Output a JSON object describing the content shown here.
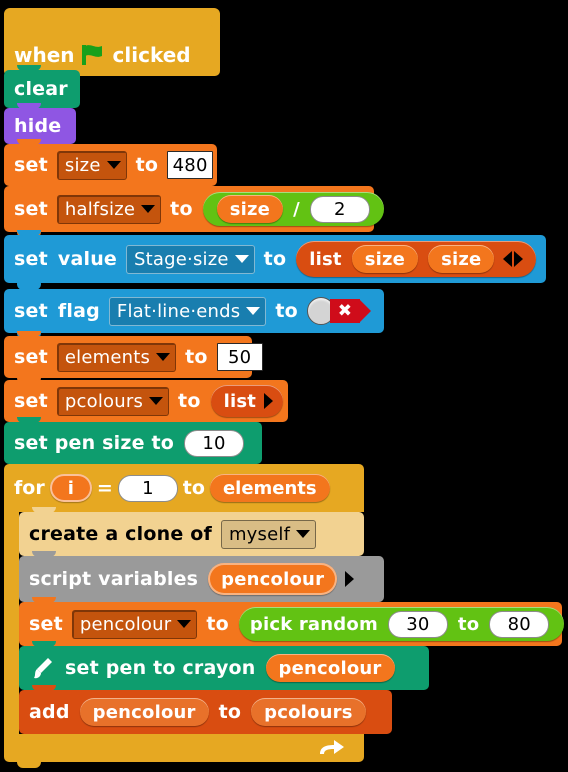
{
  "script": {
    "hat": {
      "word_when": "when",
      "icon": "green-flag-icon",
      "word_clicked": "clicked"
    },
    "blocks": [
      {
        "id": "clear",
        "label": "clear"
      },
      {
        "id": "hide",
        "label": "hide"
      },
      {
        "id": "set_size",
        "set": "set",
        "variable": "size",
        "to": "to",
        "value": "480"
      },
      {
        "id": "set_halfsize",
        "set": "set",
        "variable": "halfsize",
        "to": "to",
        "operator": {
          "left": "size",
          "symbol": "/",
          "right": "2"
        }
      },
      {
        "id": "set_value",
        "set": "set",
        "word": "value",
        "option": "Stage·size",
        "to": "to",
        "list": {
          "label": "list",
          "items": [
            "size",
            "size"
          ]
        }
      },
      {
        "id": "set_flag",
        "set": "set",
        "word": "flag",
        "option": "Flat·line·ends",
        "to": "to",
        "toggle": {
          "state": "off",
          "mark": "✖"
        }
      },
      {
        "id": "set_elements",
        "set": "set",
        "variable": "elements",
        "to": "to",
        "value": "50"
      },
      {
        "id": "set_pcolours",
        "set": "set",
        "variable": "pcolours",
        "to": "to",
        "list": {
          "label": "list",
          "items": []
        }
      },
      {
        "id": "set_pen_size",
        "label": "set pen size to",
        "value": "10"
      }
    ],
    "for_loop": {
      "word_for": "for",
      "index": "i",
      "equals": "=",
      "start": "1",
      "word_to": "to",
      "end": "elements",
      "body": [
        {
          "id": "clone",
          "label": "create a clone of",
          "option": "myself"
        },
        {
          "id": "script_vars",
          "label": "script variables",
          "vars": [
            "pencolour"
          ]
        },
        {
          "id": "set_pencolour",
          "set": "set",
          "variable": "pencolour",
          "to": "to",
          "operator": {
            "label": "pick random",
            "from": "30",
            "word_to": "to",
            "until": "80"
          }
        },
        {
          "id": "set_crayon",
          "icon": "paintbrush-icon",
          "label": "set pen to crayon",
          "arg": "pencolour"
        },
        {
          "id": "add_to_list",
          "word_add": "add",
          "item": "pencolour",
          "word_to": "to",
          "list": "pcolours"
        }
      ]
    }
  },
  "colors": {
    "control": "#e6a822",
    "pen": "#0e9d6e",
    "looks": "#8f56e3",
    "variables": "#f3761d",
    "sensing": "#1f9ad6",
    "lists": "#d94d11",
    "operators": "#62c213",
    "other": "#9a9a9a",
    "highlight": "#f2d291",
    "background": "#000000",
    "toggle_off": "#cf0c1a"
  }
}
